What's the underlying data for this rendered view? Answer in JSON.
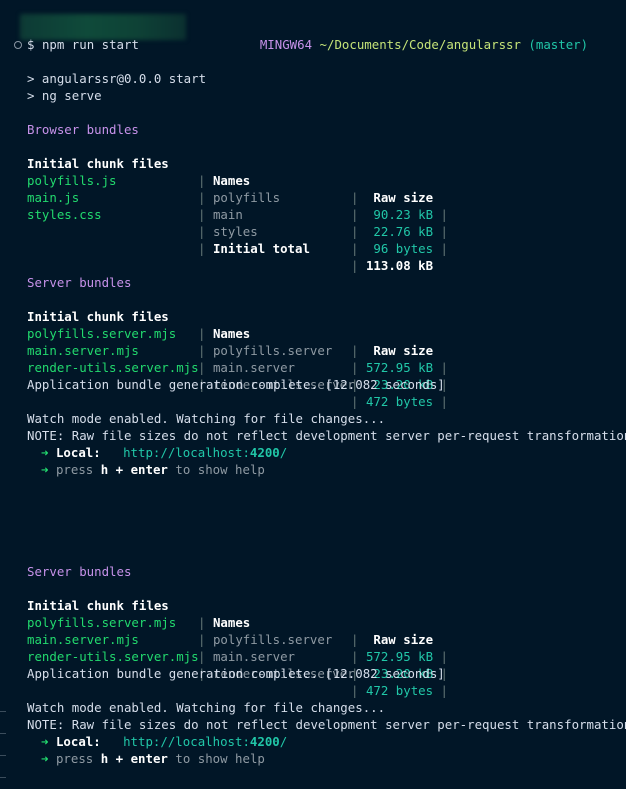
{
  "prompt": {
    "host": "MINGW64",
    "path": "~/Documents/Code/angularssr",
    "branch": "(master)",
    "symbol": "$",
    "command": "npm run start"
  },
  "npm_output": [
    "> angularssr@0.0.0 start",
    "> ng serve"
  ],
  "browser_bundles": {
    "title": "Browser bundles",
    "headers": [
      "Initial chunk files",
      "Names",
      "Raw size"
    ],
    "rows": [
      {
        "file": "polyfills.js",
        "name": "polyfills",
        "size": " 90.23 kB"
      },
      {
        "file": "main.js",
        "name": "main",
        "size": " 22.76 kB"
      },
      {
        "file": "styles.css",
        "name": "styles",
        "size": " 96 bytes"
      }
    ],
    "total_label": "Initial total",
    "total_size": "113.08 kB"
  },
  "server_bundles_1": {
    "title": "Server bundles",
    "headers": [
      "Initial chunk files",
      "Names",
      "Raw size"
    ],
    "rows": [
      {
        "file": "polyfills.server.mjs",
        "name": "polyfills.server",
        "size": "572.95 kB"
      },
      {
        "file": "main.server.mjs",
        "name": "main.server",
        "size": " 23.20 kB"
      },
      {
        "file": "render-utils.server.mjs",
        "name": "render-utils.server",
        "size": "472 bytes"
      }
    ],
    "complete": "Application bundle generation complete. [12.082 seconds]",
    "watch": "Watch mode enabled. Watching for file changes...",
    "note": "NOTE: Raw file sizes do not reflect development server per-request transformations.",
    "local_arrow": "➜",
    "local_label": "Local:",
    "local_url_prefix": "http://localhost:",
    "local_url_port": "4200",
    "local_url_suffix": "/",
    "help_press": "press",
    "help_h": "h",
    "help_plus": "+",
    "help_enter": "enter",
    "help_rest": "to show help"
  },
  "server_bundles_2": {
    "title": "Server bundles",
    "headers": [
      "Initial chunk files",
      "Names",
      "Raw size"
    ],
    "rows": [
      {
        "file": "polyfills.server.mjs",
        "name": "polyfills.server",
        "size": "572.95 kB"
      },
      {
        "file": "main.server.mjs",
        "name": "main.server",
        "size": " 23.20 kB"
      },
      {
        "file": "render-utils.server.mjs",
        "name": "render-utils.server",
        "size": "472 bytes"
      }
    ],
    "complete": "Application bundle generation complete. [12.082 seconds]",
    "watch": "Watch mode enabled. Watching for file changes...",
    "note": "NOTE: Raw file sizes do not reflect development server per-request transformations.",
    "local_arrow": "➜",
    "local_label": "Local:",
    "local_url_prefix": "http://localhost:",
    "local_url_port": "4200",
    "local_url_suffix": "/",
    "help_press": "press",
    "help_h": "h",
    "help_plus": "+",
    "help_enter": "enter",
    "help_rest": "to show help"
  },
  "pipe": "|"
}
